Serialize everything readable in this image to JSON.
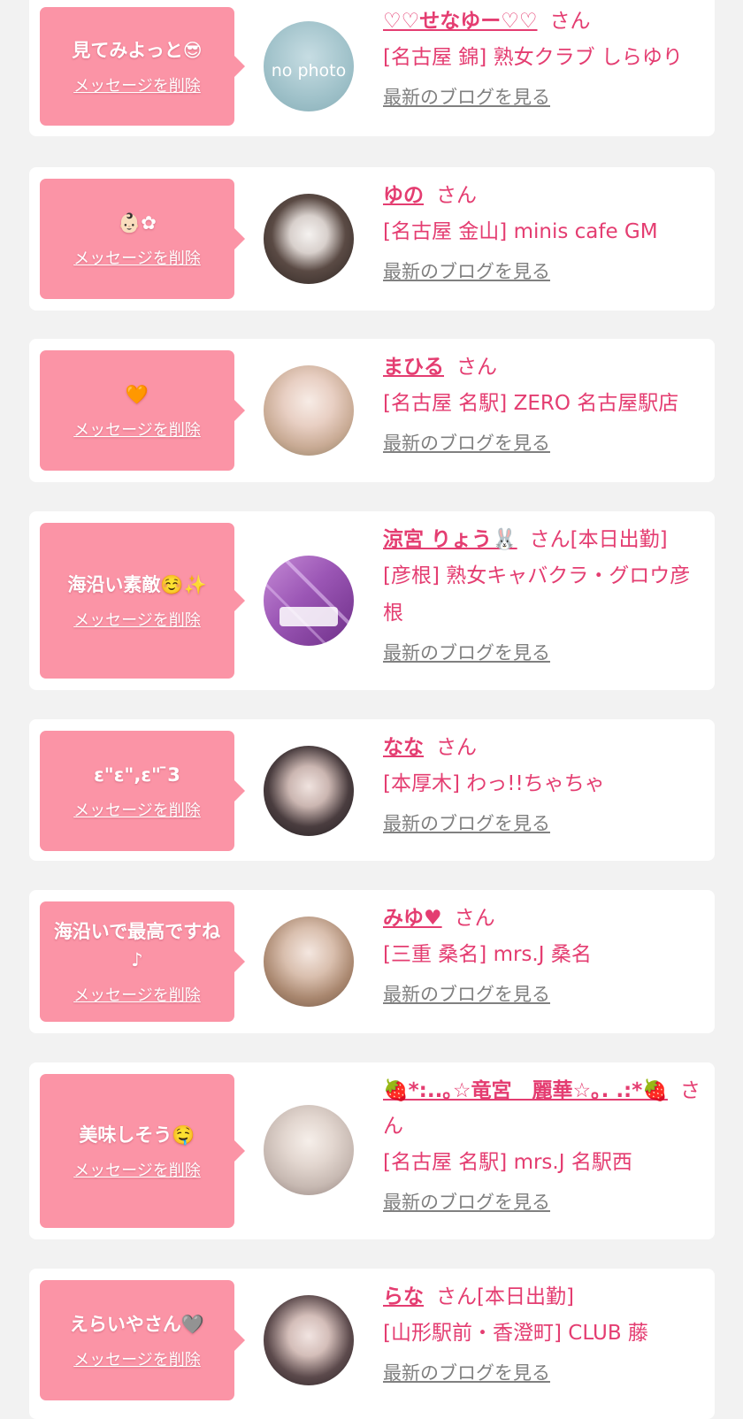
{
  "colors": {
    "page_bg": "#f2f2f2",
    "card_bg": "#ffffff",
    "bubble_bg": "#fb94a6",
    "accent_pink": "#e43d71",
    "link_gray": "#808080"
  },
  "delete_label": "メッセージを削除",
  "blog_label": "最新のブログを見る",
  "messages": [
    {
      "comment": "見てみよっと😎",
      "name": "♡♡せなゆー♡♡",
      "suffix": "さん",
      "shop": "[名古屋 錦] 熟女クラブ しらゆり",
      "avatar": "no photo"
    },
    {
      "comment": "👶🏻✿",
      "name": "ゆの",
      "suffix": "さん",
      "shop": "[名古屋 金山] minis cafe GM",
      "avatar": "photo"
    },
    {
      "comment": "🧡",
      "name": "まひる",
      "suffix": "さん",
      "shop": "[名古屋 名駅] ZERO 名古屋駅店",
      "avatar": "photo"
    },
    {
      "comment": "海沿い素敵☺️✨",
      "name": "涼宮 りょう🐰",
      "suffix": "さん[本日出勤]",
      "shop": "[彦根] 熟女キャバクラ・グロウ彦根",
      "avatar": "glow"
    },
    {
      "comment": "ε\"ε\",ε\" ̄3",
      "name": "なな",
      "suffix": "さん",
      "shop": "[本厚木] わっ!!ちゃちゃ",
      "avatar": "photo"
    },
    {
      "comment": "海沿いで最高ですね♪",
      "name": "みゆ♥",
      "suffix": "さん",
      "shop": "[三重 桑名] mrs.J 桑名",
      "avatar": "photo"
    },
    {
      "comment": "美味しそう🤤",
      "name": "🍓*:..｡☆竜宮　麗華☆｡. .:*🍓",
      "suffix": "さん",
      "shop": "[名古屋 名駅] mrs.J 名駅西",
      "avatar": "photo"
    },
    {
      "comment": "えらいやさん🩶",
      "name": "らな",
      "suffix": "さん[本日出勤]",
      "shop": "[山形駅前・香澄町] CLUB 藤",
      "avatar": "photo"
    }
  ]
}
